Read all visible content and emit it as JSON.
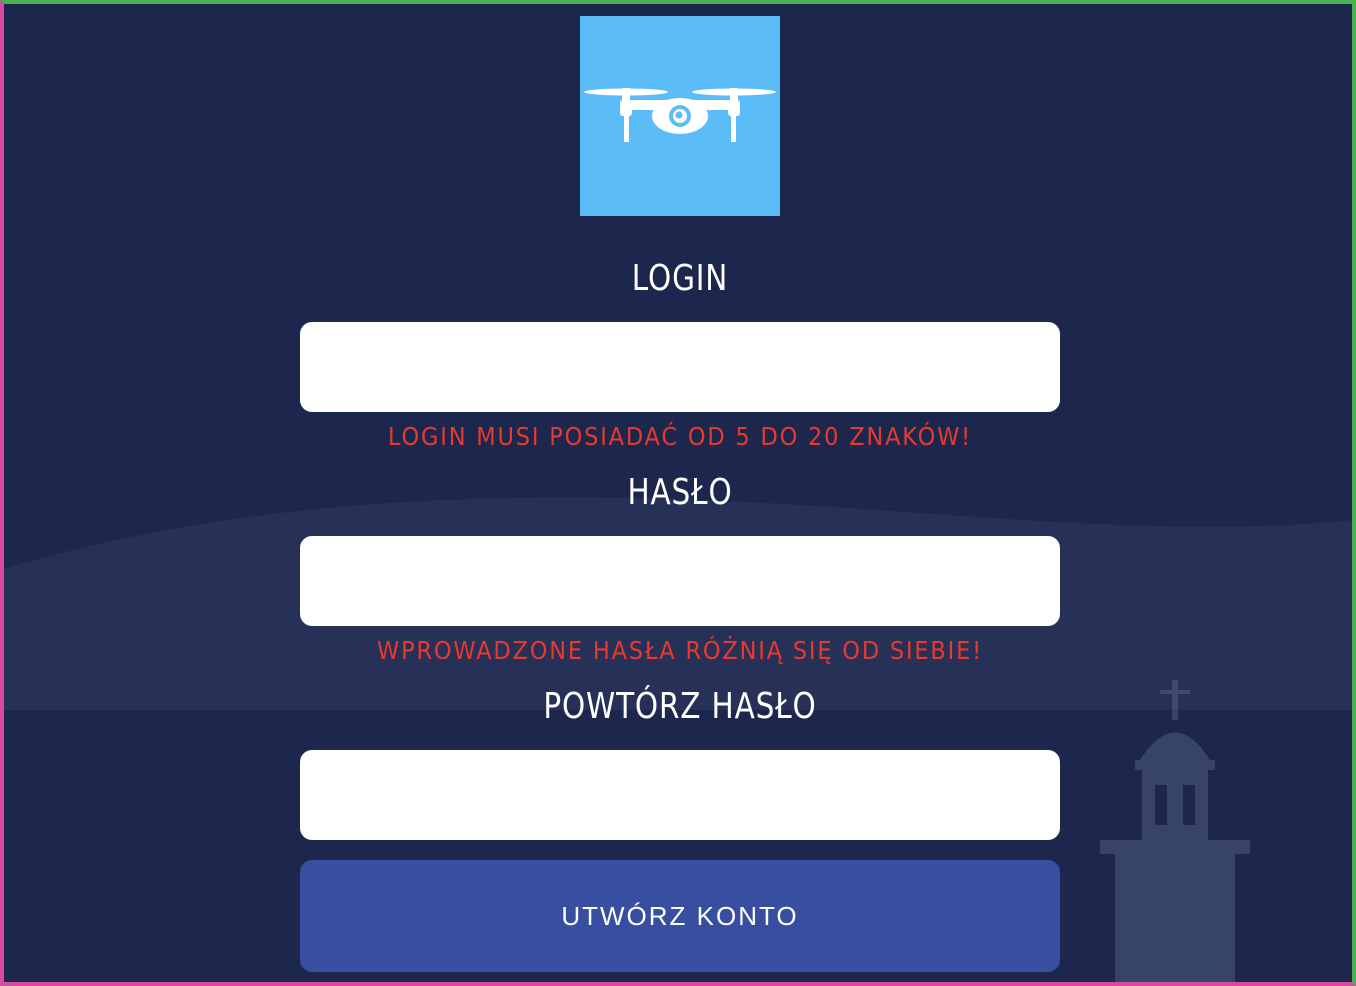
{
  "colors": {
    "background": "#1d274d",
    "logo_bg": "#5bbcf7",
    "error": "#e7392c",
    "button_bg": "#374ea1",
    "input_bg": "#ffffff"
  },
  "logo": {
    "icon": "drone-icon"
  },
  "form": {
    "login": {
      "label": "LOGIN",
      "value": "",
      "placeholder": "",
      "error": "LOGIN MUSI POSIADAĆ OD 5 DO 20 ZNAKÓW!"
    },
    "password": {
      "label": "HASŁO",
      "value": "",
      "placeholder": "",
      "error": "WPROWADZONE HASŁA RÓŻNIĄ SIĘ OD SIEBIE!"
    },
    "repeat_password": {
      "label": "POWTÓRZ HASŁO",
      "value": "",
      "placeholder": ""
    },
    "submit_label": "UTWÓRZ KONTO"
  }
}
